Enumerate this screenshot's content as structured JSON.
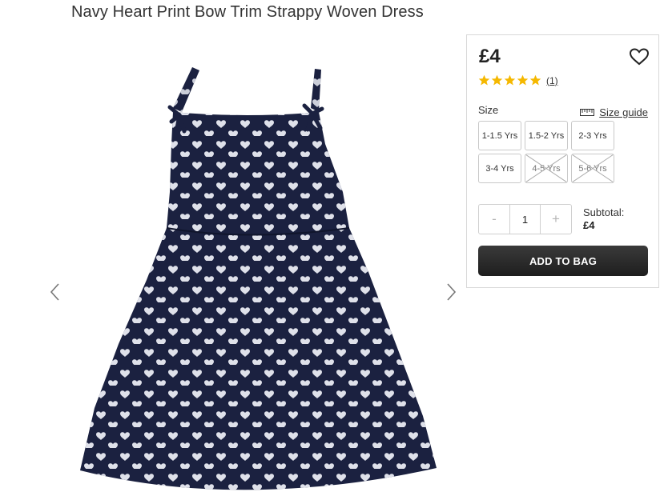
{
  "product": {
    "title": "Navy Heart Print Bow Trim Strappy Woven Dress"
  },
  "gallery": {
    "prev_icon": "chevron-left-icon",
    "next_icon": "chevron-right-icon",
    "dress_color": "#1b2140",
    "heart_color": "#dfe1ea"
  },
  "panel": {
    "price": "£4",
    "wishlist_icon": "heart-outline-icon",
    "rating": 5,
    "review_count": "(1)",
    "star_color": "#f5b800",
    "size_label": "Size",
    "size_guide_label": "Size guide",
    "size_guide_icon": "ruler-icon",
    "sizes": [
      {
        "label": "1-1.5 Yrs",
        "available": true
      },
      {
        "label": "1.5-2 Yrs",
        "available": true
      },
      {
        "label": "2-3 Yrs",
        "available": true
      },
      {
        "label": "3-4 Yrs",
        "available": true
      },
      {
        "label": "4-5 Yrs",
        "available": false
      },
      {
        "label": "5-6 Yrs",
        "available": false
      }
    ],
    "quantity": {
      "minus": "-",
      "value": "1",
      "plus": "+"
    },
    "subtotal_label": "Subtotal:",
    "subtotal_value": "£4",
    "add_to_bag": "ADD TO BAG"
  }
}
